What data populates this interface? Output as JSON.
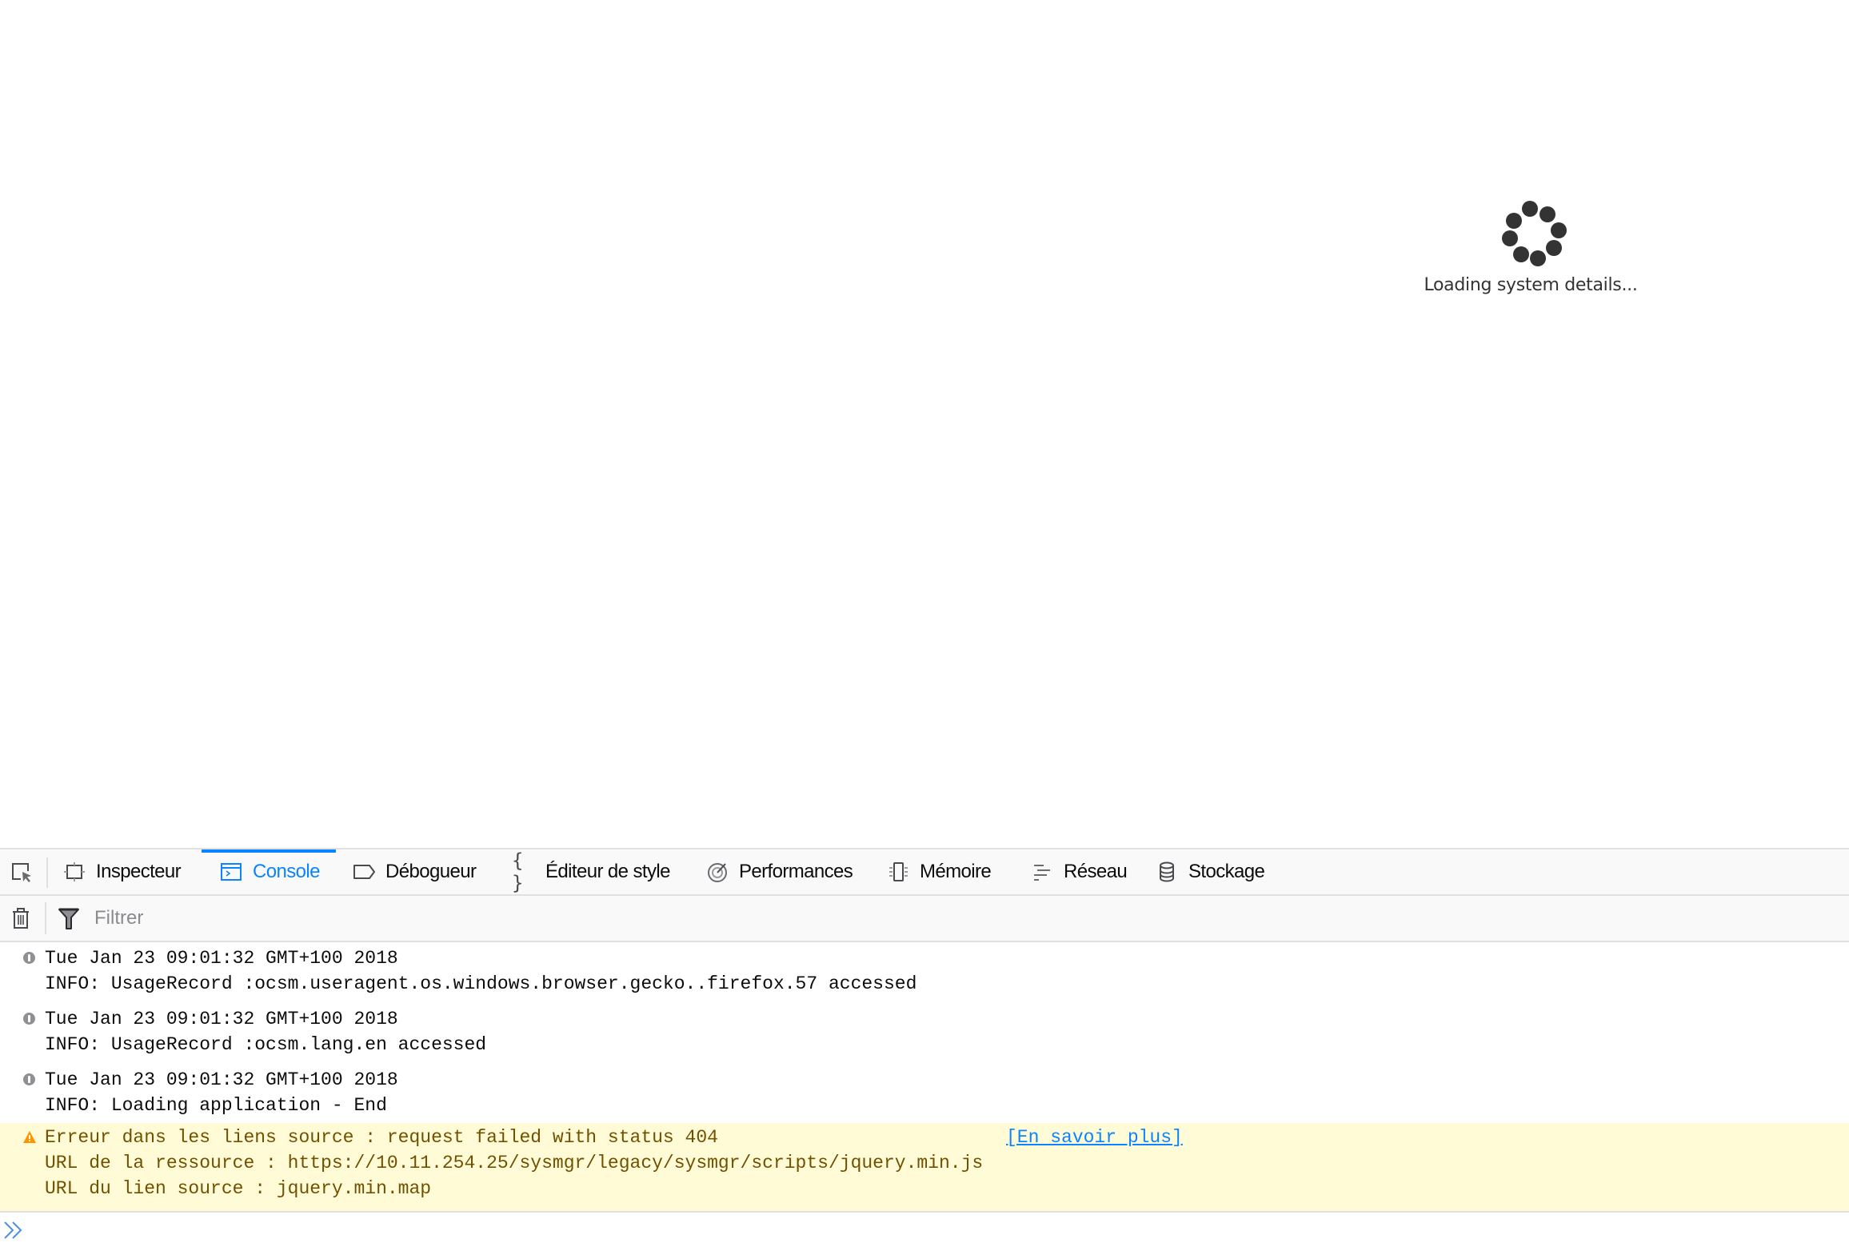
{
  "page": {
    "loading_text": "Loading system details..."
  },
  "devtools": {
    "tabs": [
      {
        "label": "Inspecteur",
        "icon": "inspector-icon",
        "active": false
      },
      {
        "label": "Console",
        "icon": "console-icon",
        "active": true
      },
      {
        "label": "Débogueur",
        "icon": "debugger-icon",
        "active": false
      },
      {
        "label": "Éditeur de style",
        "icon": "style-editor-icon",
        "active": false
      },
      {
        "label": "Performances",
        "icon": "performance-icon",
        "active": false
      },
      {
        "label": "Mémoire",
        "icon": "memory-icon",
        "active": false
      },
      {
        "label": "Réseau",
        "icon": "network-icon",
        "active": false
      },
      {
        "label": "Stockage",
        "icon": "storage-icon",
        "active": false
      }
    ],
    "accent_color": "#0a84ff",
    "filter": {
      "placeholder": "Filtrer",
      "value": ""
    },
    "messages": [
      {
        "level": "info",
        "lines": [
          "Tue Jan 23 09:01:32 GMT+100 2018",
          "INFO: UsageRecord :ocsm.useragent.os.windows.browser.gecko..firefox.57 accessed"
        ]
      },
      {
        "level": "info",
        "lines": [
          "Tue Jan 23 09:01:32 GMT+100 2018",
          "INFO: UsageRecord :ocsm.lang.en accessed"
        ]
      },
      {
        "level": "info",
        "lines": [
          "Tue Jan 23 09:01:32 GMT+100 2018",
          "INFO: Loading application - End"
        ]
      },
      {
        "level": "warning",
        "lines": [
          "Erreur dans les liens source : request failed with status 404",
          "URL de la ressource : https://10.11.254.25/sysmgr/legacy/sysmgr/scripts/jquery.min.js",
          "URL du lien source : jquery.min.map"
        ],
        "link": "[En savoir plus]"
      }
    ],
    "prompt_value": ""
  }
}
